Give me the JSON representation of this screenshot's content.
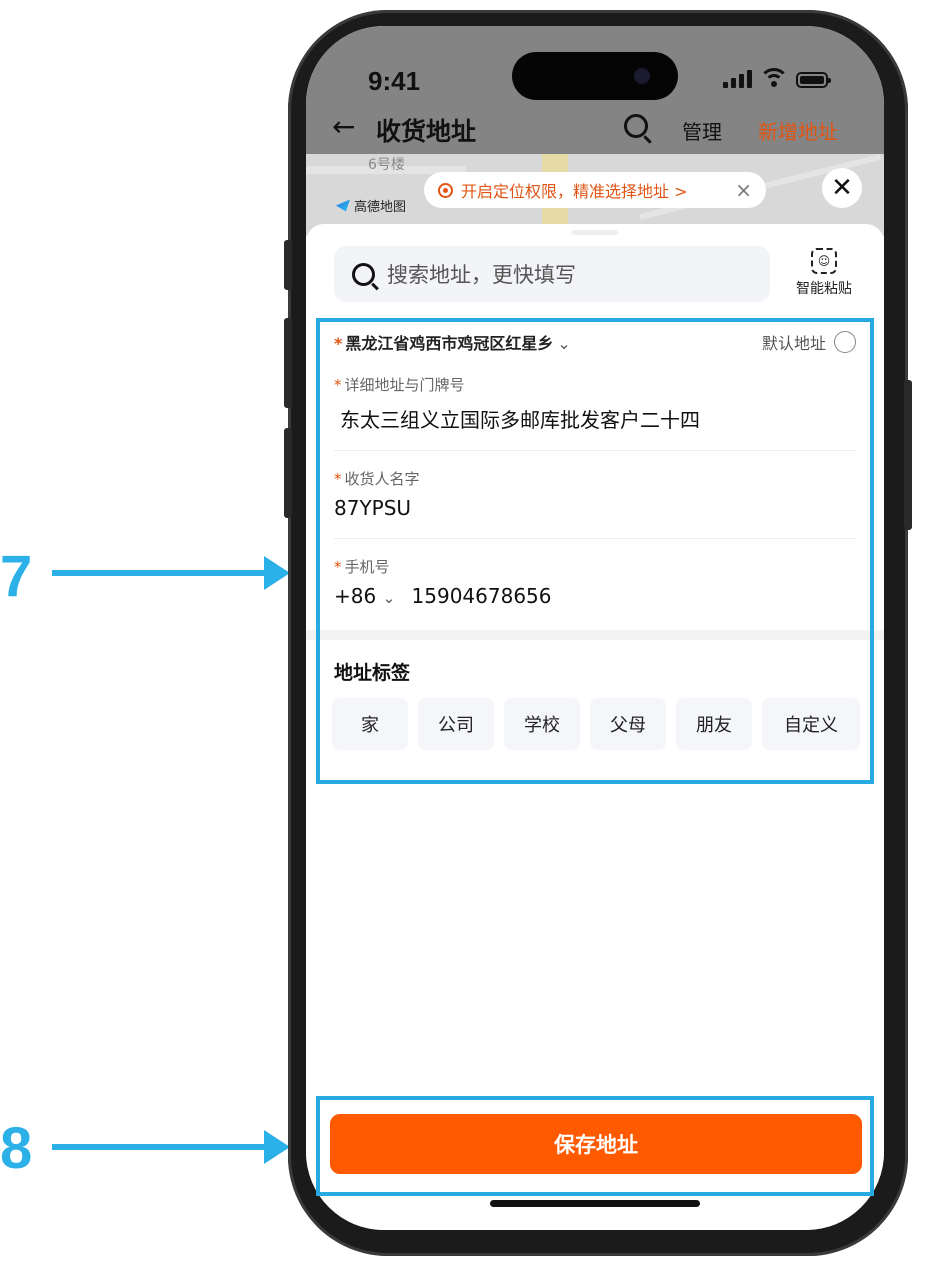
{
  "callouts": [
    {
      "label": "7"
    },
    {
      "label": "8"
    }
  ],
  "status_bar": {
    "time": "9:41"
  },
  "nav": {
    "back_icon": "←",
    "title": "收货地址",
    "manage": "管理",
    "add": "新增地址",
    "add_color": "#e05513"
  },
  "map": {
    "building_label": "6号楼",
    "logo_text": "高德地图",
    "location_prompt": "开启定位权限，精准选择地址 >",
    "prompt_close": "×",
    "close": "✕"
  },
  "search": {
    "placeholder": "搜索地址，更快填写"
  },
  "smart_paste": {
    "icon_text": "☺",
    "label": "智能粘贴"
  },
  "form": {
    "required_mark": "*",
    "region": "黑龙江省鸡西市鸡冠区红星乡",
    "region_chevron": "⌄",
    "default_label": "默认地址",
    "detail_label": "详细地址与门牌号",
    "detail_value": "东太三组义立国际多邮库批发客户二十四",
    "name_label": "收货人名字",
    "name_value": "87YPSU",
    "phone_label": "手机号",
    "phone_code": "+86",
    "phone_chevron": "⌄",
    "phone_value": "15904678656"
  },
  "tags": {
    "title": "地址标签",
    "items": [
      "家",
      "公司",
      "学校",
      "父母",
      "朋友",
      "自定义"
    ]
  },
  "save_button": {
    "label": "保存地址",
    "color": "#ff5a00"
  },
  "highlight_color": "#27a9e1"
}
